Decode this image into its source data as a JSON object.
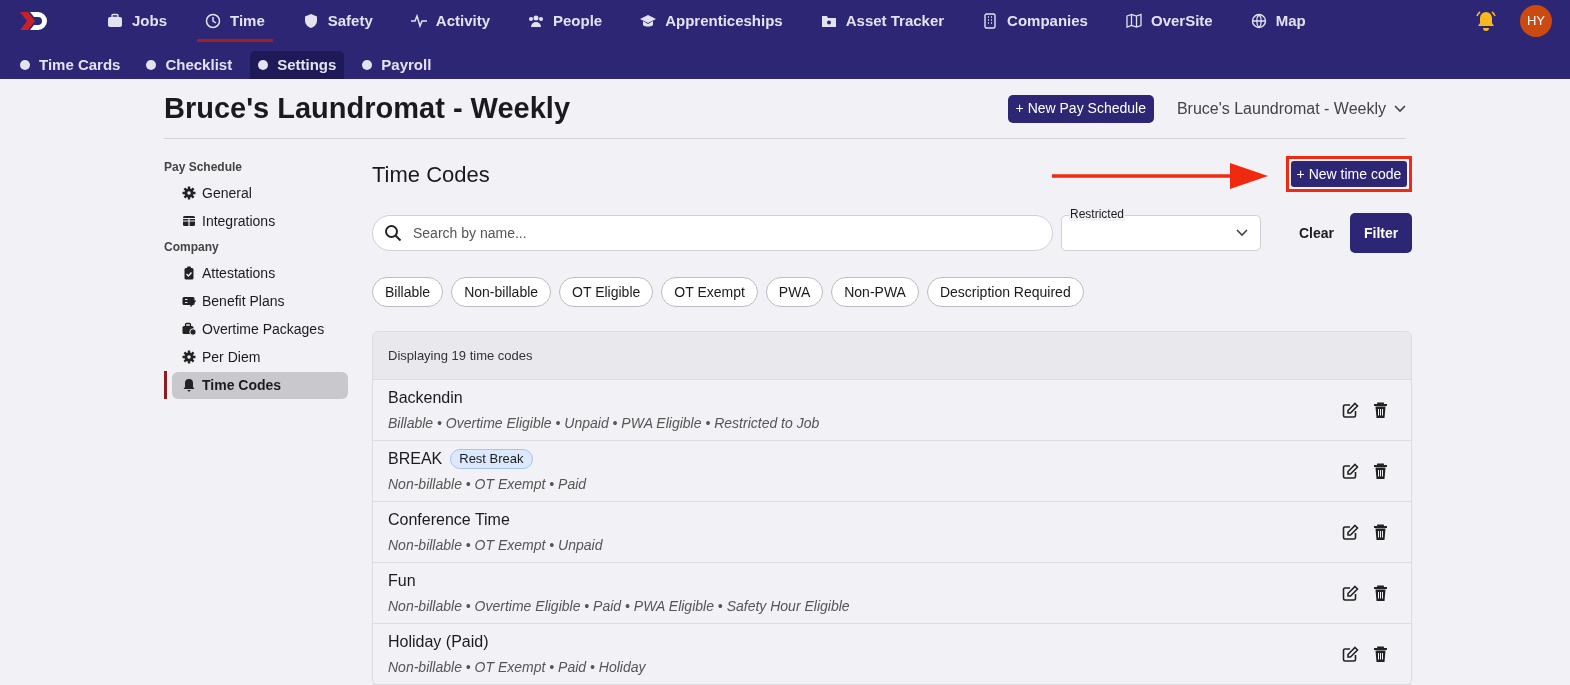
{
  "nav": [
    {
      "label": "Jobs",
      "selected": false
    },
    {
      "label": "Time",
      "selected": true
    },
    {
      "label": "Safety",
      "selected": false
    },
    {
      "label": "Activity",
      "selected": false
    },
    {
      "label": "People",
      "selected": false
    },
    {
      "label": "Apprenticeships",
      "selected": false
    },
    {
      "label": "Asset Tracker",
      "selected": false
    },
    {
      "label": "Companies",
      "selected": false
    },
    {
      "label": "OverSite",
      "selected": false
    },
    {
      "label": "Map",
      "selected": false
    }
  ],
  "user": {
    "initials": "HY"
  },
  "subnav": [
    {
      "label": "Time Cards",
      "selected": false
    },
    {
      "label": "Checklist",
      "selected": false
    },
    {
      "label": "Settings",
      "selected": true
    },
    {
      "label": "Payroll",
      "selected": false
    }
  ],
  "page": {
    "title": "Bruce's Laundromat - Weekly",
    "new_button": "+ New Pay Schedule",
    "schedule_select": "Bruce's Laundromat - Weekly"
  },
  "sidebar": [
    {
      "heading": "Pay Schedule",
      "items": [
        {
          "label": "General",
          "selected": false
        },
        {
          "label": "Integrations",
          "selected": false
        }
      ]
    },
    {
      "heading": "Company",
      "items": [
        {
          "label": "Attestations",
          "selected": false
        },
        {
          "label": "Benefit Plans",
          "selected": false
        },
        {
          "label": "Overtime Packages",
          "selected": false
        },
        {
          "label": "Per Diem",
          "selected": false
        },
        {
          "label": "Time Codes",
          "selected": true
        }
      ]
    }
  ],
  "main": {
    "title": "Time Codes",
    "new_button": "+ New time code",
    "search": {
      "placeholder": "Search by name..."
    },
    "restricted": {
      "label": "Restricted"
    },
    "clear": "Clear",
    "filter": "Filter",
    "chips": [
      "Billable",
      "Non-billable",
      "OT Eligible",
      "OT Exempt",
      "PWA",
      "Non-PWA",
      "Description Required"
    ],
    "count": "Displaying 19 time codes",
    "rows": [
      {
        "name": "Backendin",
        "details": "Billable • Overtime Eligible • Unpaid • PWA Eligible • Restricted to Job"
      },
      {
        "name": "BREAK",
        "tag": "Rest Break",
        "details": "Non-billable • OT Exempt • Paid"
      },
      {
        "name": "Conference Time",
        "details": "Non-billable • OT Exempt • Unpaid"
      },
      {
        "name": "Fun",
        "details": "Non-billable • Overtime Eligible • Paid • PWA Eligible • Safety Hour Eligible"
      },
      {
        "name": "Holiday (Paid)",
        "details": "Non-billable • OT Exempt • Paid • Holiday"
      }
    ]
  }
}
